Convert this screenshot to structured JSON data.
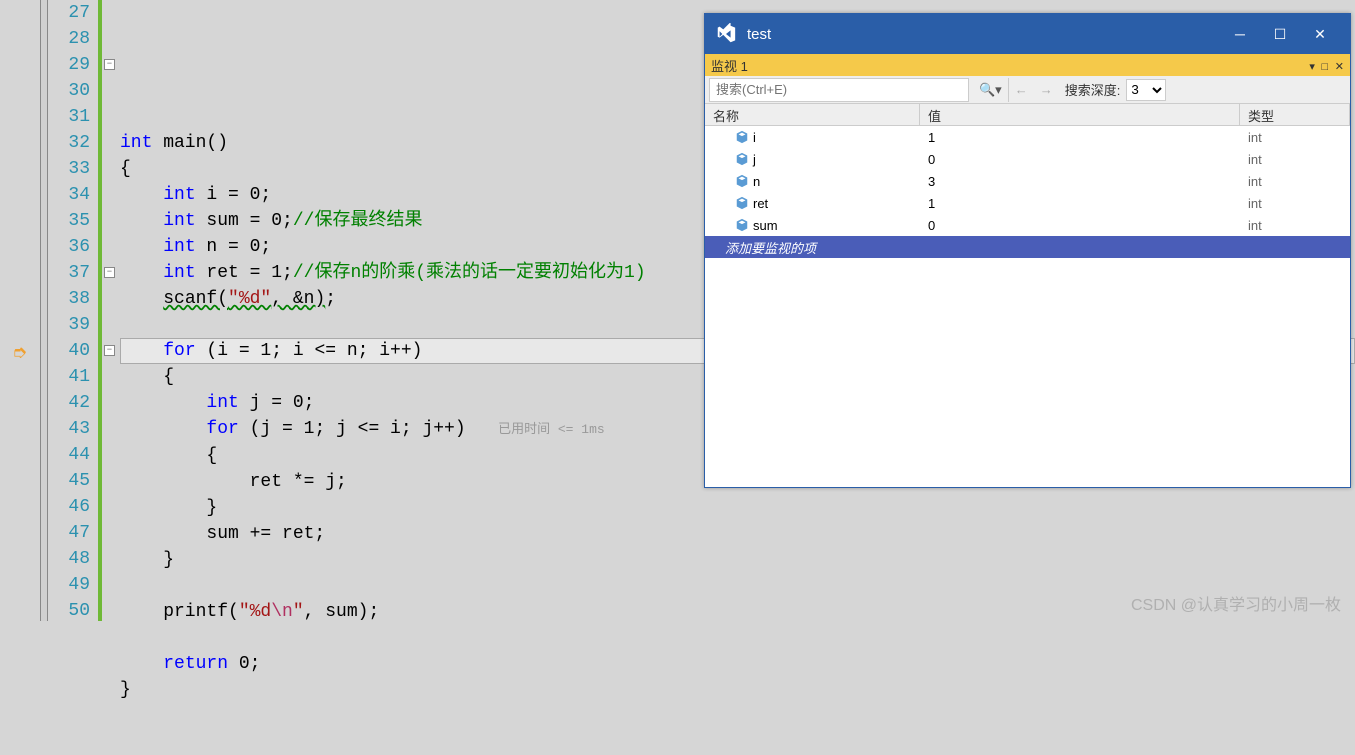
{
  "editor": {
    "first_line": 27,
    "current_line": 40,
    "lines": [
      "",
      "",
      "int main()",
      "{",
      "    int i = 0;",
      "    int sum = 0;//保存最终结果",
      "    int n = 0;",
      "    int ret = 1;//保存n的阶乘(乘法的话一定要初始化为1)",
      "    scanf(\"%d\", &n);",
      "",
      "    for (i = 1; i <= n; i++)",
      "    {",
      "        int j = 0;",
      "        for (j = 1; j <= i; j++)",
      "        {",
      "            ret *= j;",
      "        }",
      "        sum += ret;",
      "    }",
      "",
      "    printf(\"%d\\n\", sum);",
      "",
      "    return 0;",
      "}"
    ],
    "perf_hint": "已用时间 <= 1ms"
  },
  "watch": {
    "title": "test",
    "tab": "监视 1",
    "search_placeholder": "搜索(Ctrl+E)",
    "depth_label": "搜索深度:",
    "depth_value": "3",
    "headers": {
      "name": "名称",
      "value": "值",
      "type": "类型"
    },
    "rows": [
      {
        "name": "i",
        "value": "1",
        "type": "int"
      },
      {
        "name": "j",
        "value": "0",
        "type": "int"
      },
      {
        "name": "n",
        "value": "3",
        "type": "int"
      },
      {
        "name": "ret",
        "value": "1",
        "type": "int"
      },
      {
        "name": "sum",
        "value": "0",
        "type": "int"
      }
    ],
    "add_item": "添加要监视的项"
  },
  "watermark": "CSDN @认真学习的小周一枚"
}
